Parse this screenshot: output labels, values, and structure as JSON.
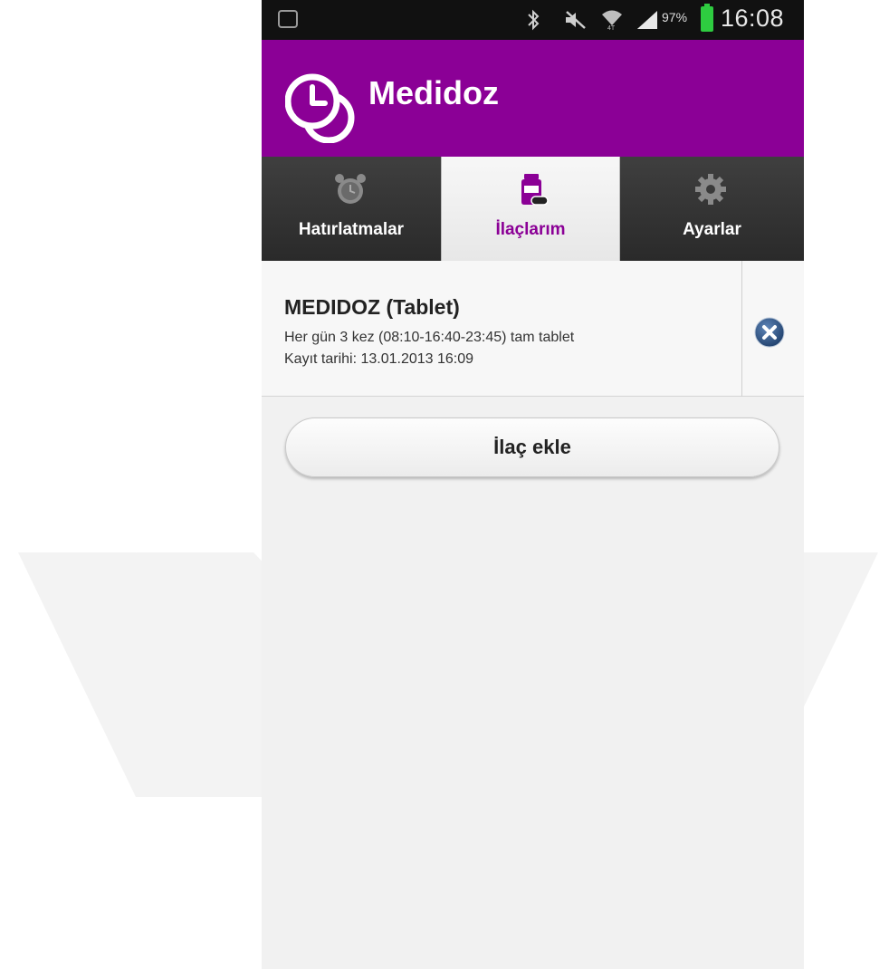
{
  "status_bar": {
    "battery_percent": "97%",
    "time": "16:08",
    "icons": [
      "notification-icon",
      "bluetooth-icon",
      "mute-icon",
      "wifi-icon",
      "signal-icon",
      "battery-icon"
    ]
  },
  "app": {
    "title": "Medidoz",
    "brand_color": "#8b0096"
  },
  "tabs": [
    {
      "label": "Hatırlatmalar",
      "icon": "alarm-clock-icon",
      "selected": false
    },
    {
      "label": "İlaçlarım",
      "icon": "medicine-bottle-icon",
      "selected": true
    },
    {
      "label": "Ayarlar",
      "icon": "gear-icon",
      "selected": false
    }
  ],
  "medications": [
    {
      "title": "MEDIDOZ (Tablet)",
      "schedule": "Her gün 3 kez (08:10-16:40-23:45) tam tablet",
      "registered": "Kayıt tarihi: 13.01.2013 16:09"
    }
  ],
  "add_button": {
    "label": "İlaç ekle"
  }
}
